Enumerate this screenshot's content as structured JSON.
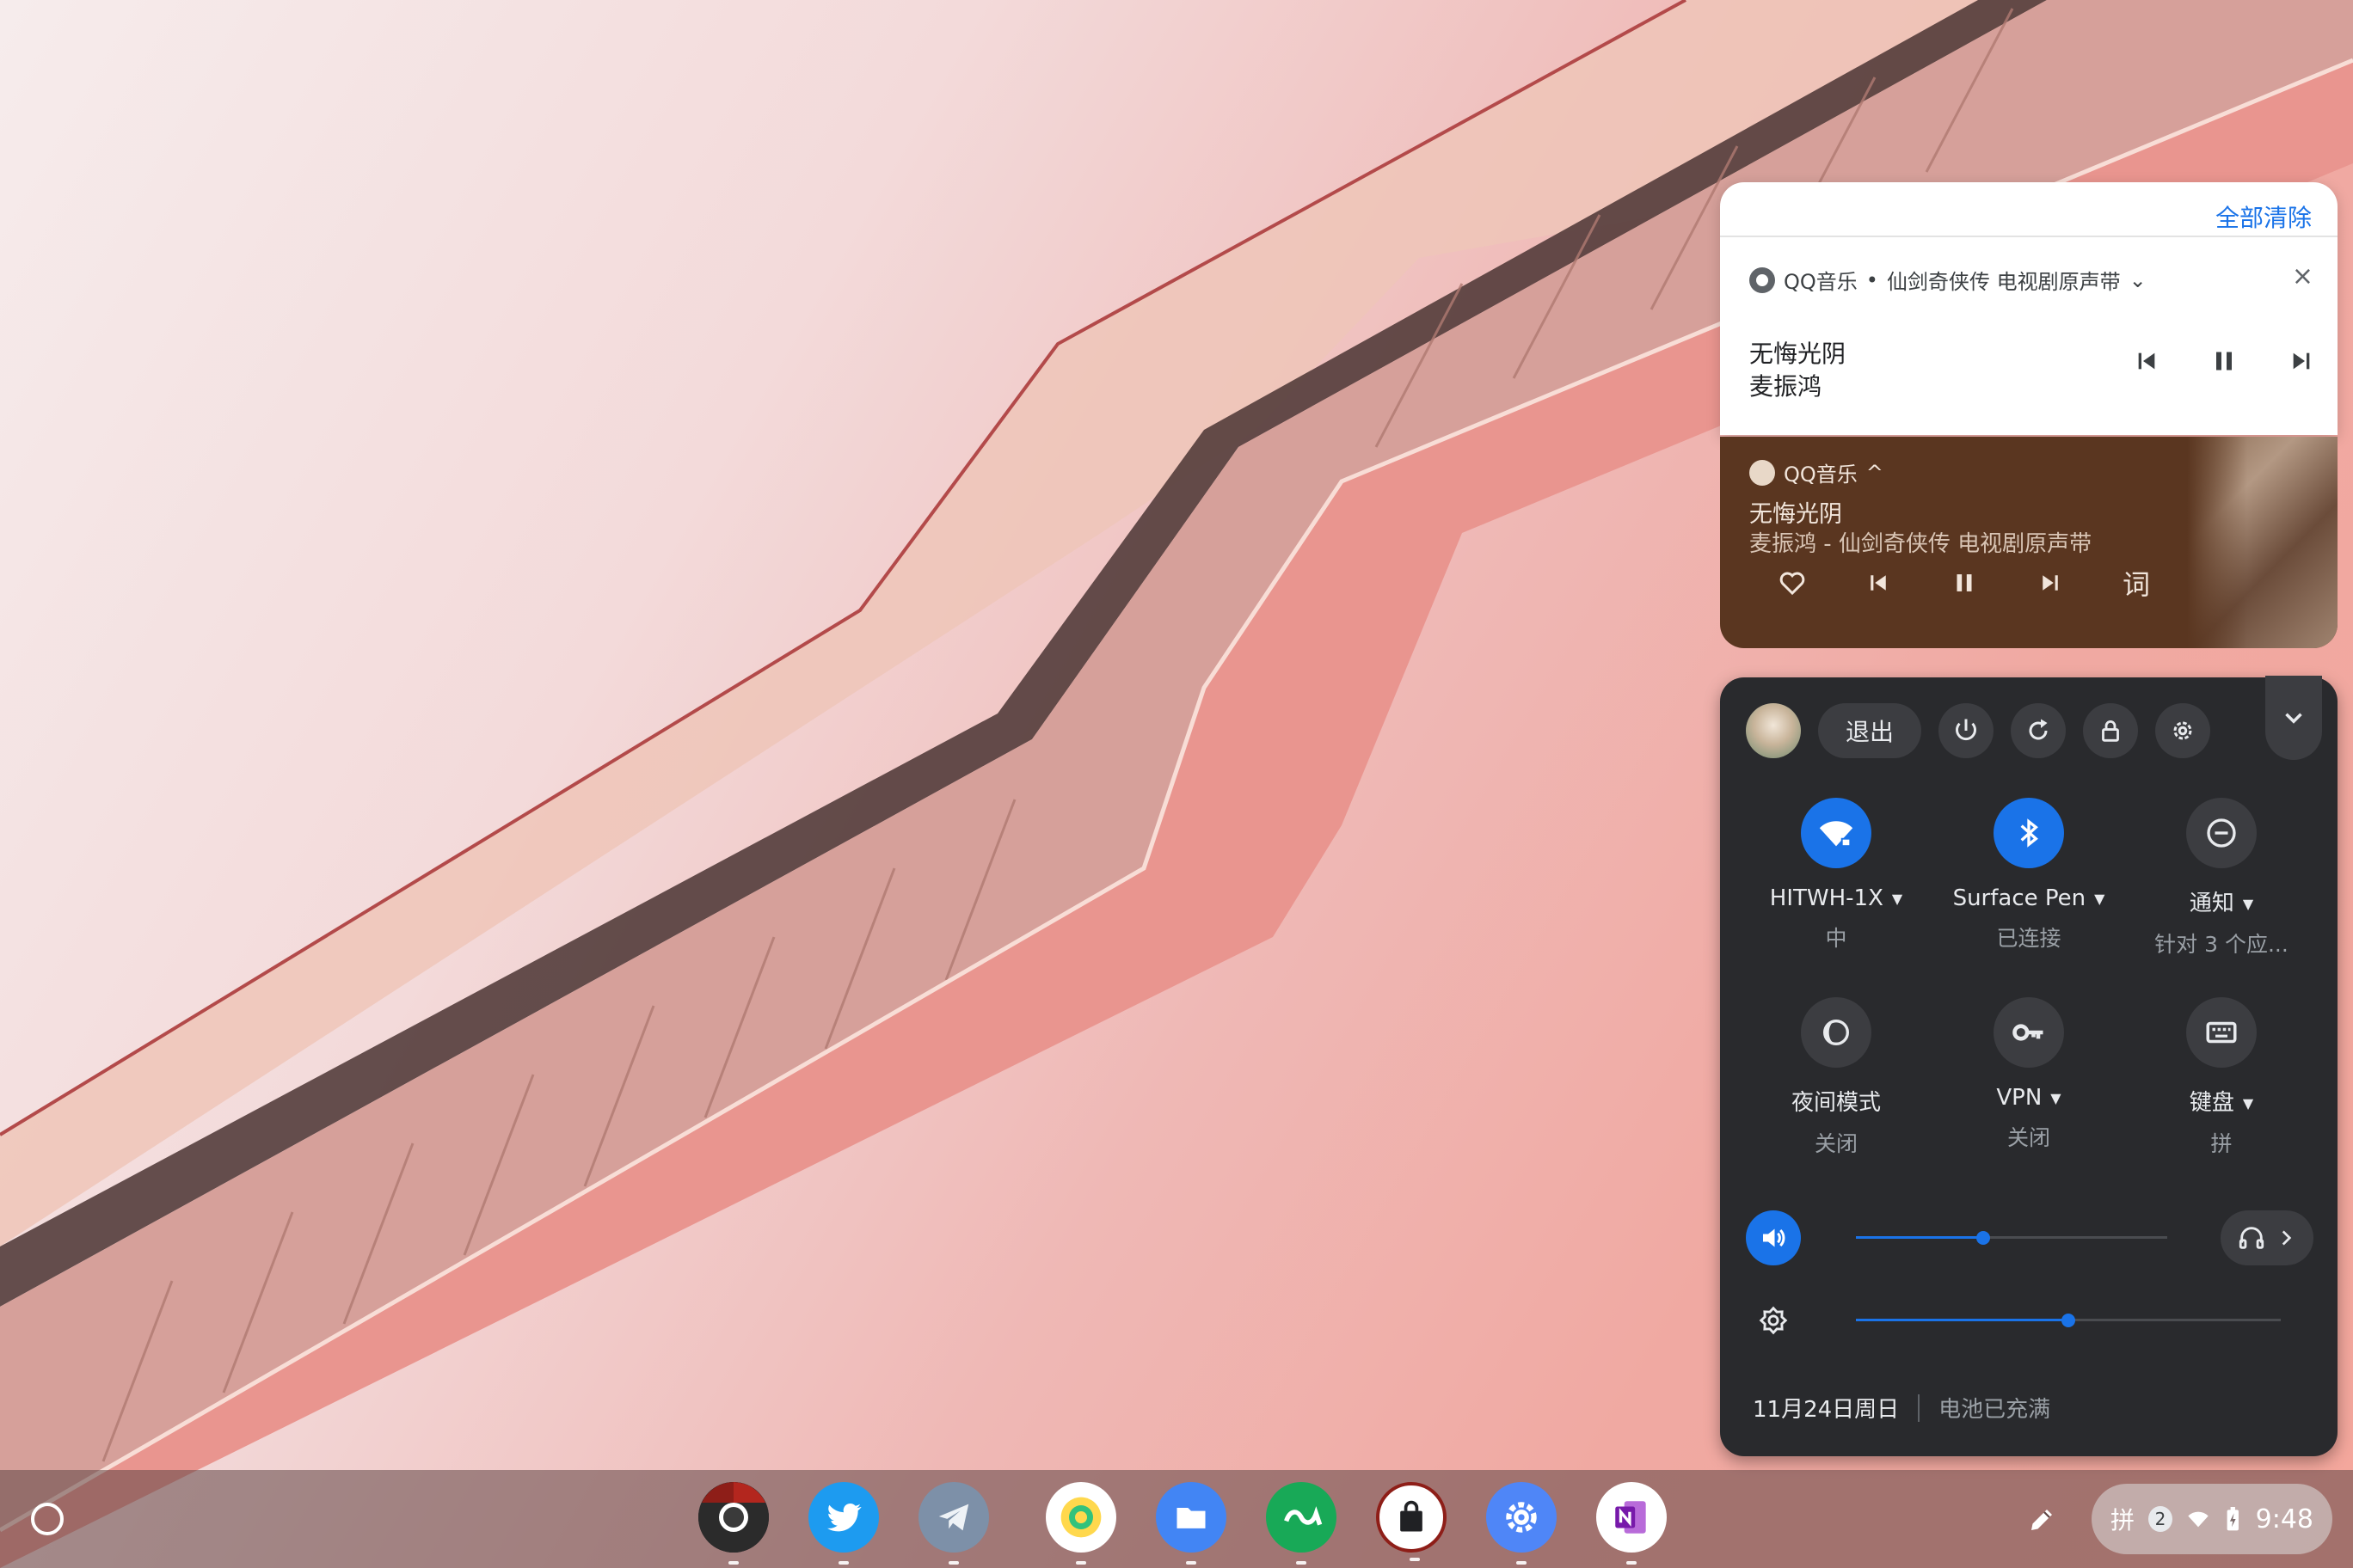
{
  "notifications": {
    "clear_all": "全部清除",
    "chrome_notif": {
      "app": "QQ音乐",
      "bullet": "•",
      "source": "仙剑奇侠传 电视剧原声带",
      "expand_chevron": "⌄",
      "close_icon": "×",
      "title": "无悔光阴",
      "artist": "麦振鸿"
    },
    "media_card": {
      "app": "QQ音乐",
      "expand_chevron": "^",
      "title": "无悔光阴",
      "subtitle": "麦振鸿 - 仙剑奇侠传 电视剧原声带",
      "lyrics_label": "词"
    }
  },
  "quick_settings": {
    "signout_label": "退出",
    "tiles": [
      {
        "label": "HITWH-1X",
        "sub": "中",
        "state": "on",
        "icon": "wifi-icon"
      },
      {
        "label": "Surface Pen",
        "sub": "已连接",
        "state": "on",
        "icon": "bluetooth-icon"
      },
      {
        "label": "通知",
        "sub": "针对 3 个应...",
        "state": "off",
        "icon": "do-not-disturb-icon"
      },
      {
        "label": "夜间模式",
        "sub": "关闭",
        "state": "off",
        "icon": "night-light-icon"
      },
      {
        "label": "VPN",
        "sub": "关闭",
        "state": "off",
        "icon": "vpn-key-icon"
      },
      {
        "label": "键盘",
        "sub": "拼",
        "state": "off",
        "icon": "keyboard-icon"
      }
    ],
    "volume": {
      "level": 0.41
    },
    "brightness": {
      "level": 0.5
    },
    "date": "11月24日周日",
    "battery": "电池已充满"
  },
  "shelf": {
    "apps": [
      "Chrome",
      "Twitter",
      "Telegram",
      "QQ音乐",
      "Files",
      "CAJViewer",
      "Shop",
      "Settings",
      "OneNote"
    ],
    "tray": {
      "ime": "拼",
      "notif_count": "2",
      "time": "9:48"
    }
  },
  "colors": {
    "accent": "#1a73e8",
    "qs_bg": "#292a2d",
    "media_bg": "#5a3620"
  }
}
